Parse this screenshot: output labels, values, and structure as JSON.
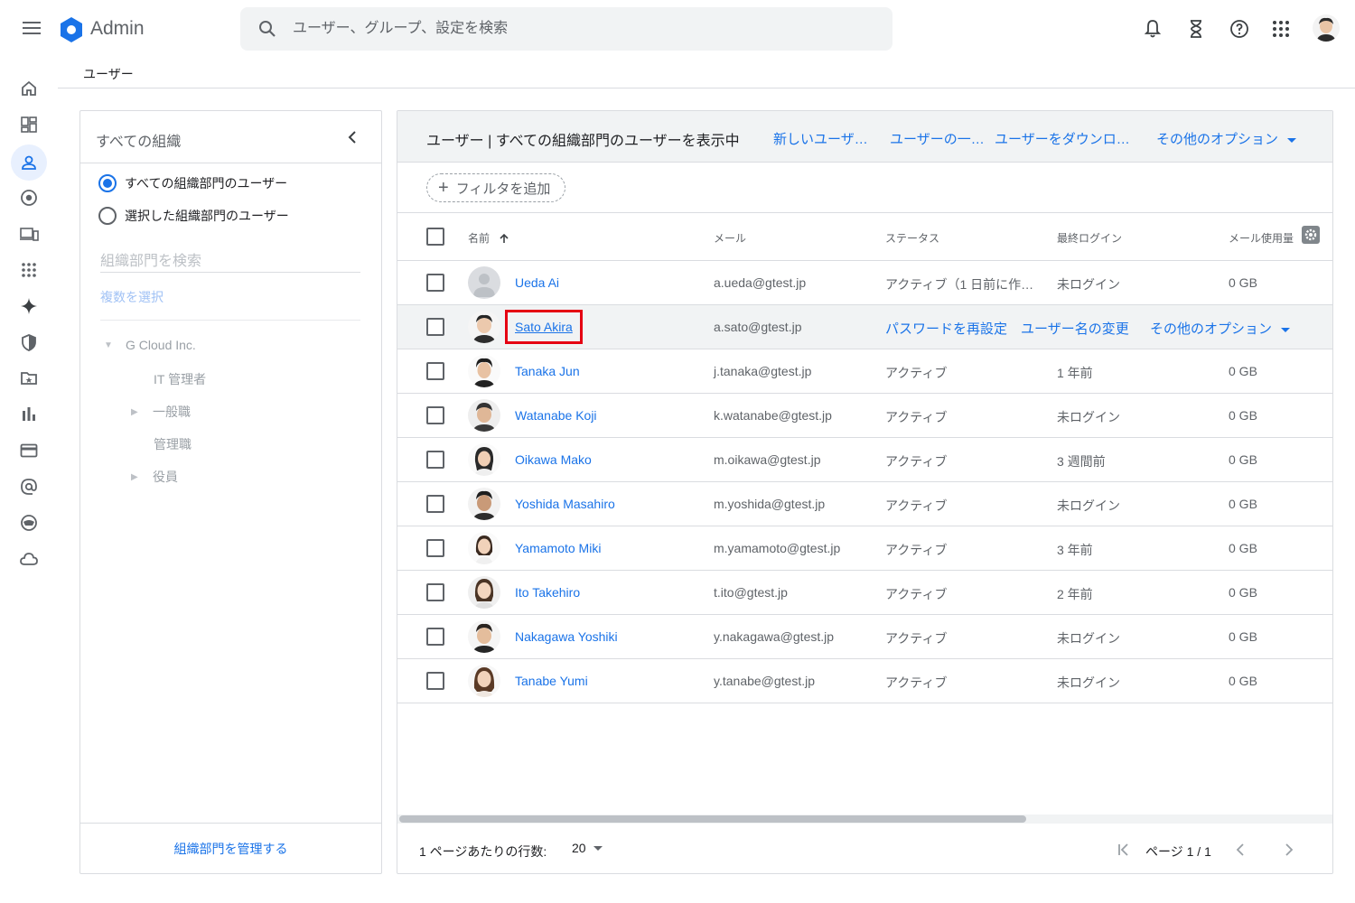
{
  "app": {
    "title": "Admin"
  },
  "search": {
    "placeholder": "ユーザー、グループ、設定を検索"
  },
  "breadcrumb": "ユーザー",
  "org_panel": {
    "title": "すべての組織",
    "radio_all": "すべての組織部門のユーザー",
    "radio_selected": "選択した組織部門のユーザー",
    "search_placeholder": "組織部門を検索",
    "multi_select": "複数を選択",
    "tree": [
      {
        "label": "G Cloud Inc."
      },
      {
        "label": "IT 管理者"
      },
      {
        "label": "一般職"
      },
      {
        "label": "管理職"
      },
      {
        "label": "役員"
      }
    ],
    "manage_link": "組織部門を管理する"
  },
  "users_panel": {
    "title": "ユーザー | すべての組織部門のユーザーを表示中",
    "links": {
      "new_user": "新しいユーザ…",
      "list": "ユーザーの一…",
      "download": "ユーザーをダウンロ…",
      "more": "その他のオプション"
    },
    "add_filter": "フィルタを追加",
    "columns": {
      "name": "名前",
      "email": "メール",
      "status": "ステータス",
      "last_login": "最終ログイン",
      "mail_usage": "メール使用量"
    },
    "rows": [
      {
        "name": "Ueda Ai",
        "email": "a.ueda@gtest.jp",
        "status": "アクティブ（1 日前に作…",
        "last_login": "未ログイン",
        "usage": "0 GB"
      },
      {
        "name": "Sato Akira",
        "email": "a.sato@gtest.jp",
        "status": "",
        "last_login": "",
        "usage": ""
      },
      {
        "name": "Tanaka Jun",
        "email": "j.tanaka@gtest.jp",
        "status": "アクティブ",
        "last_login": "1 年前",
        "usage": "0 GB"
      },
      {
        "name": "Watanabe Koji",
        "email": "k.watanabe@gtest.jp",
        "status": "アクティブ",
        "last_login": "未ログイン",
        "usage": "0 GB"
      },
      {
        "name": "Oikawa Mako",
        "email": "m.oikawa@gtest.jp",
        "status": "アクティブ",
        "last_login": "3 週間前",
        "usage": "0 GB"
      },
      {
        "name": "Yoshida Masahiro",
        "email": "m.yoshida@gtest.jp",
        "status": "アクティブ",
        "last_login": "未ログイン",
        "usage": "0 GB"
      },
      {
        "name": "Yamamoto Miki",
        "email": "m.yamamoto@gtest.jp",
        "status": "アクティブ",
        "last_login": "3 年前",
        "usage": "0 GB"
      },
      {
        "name": "Ito Takehiro",
        "email": "t.ito@gtest.jp",
        "status": "アクティブ",
        "last_login": "2 年前",
        "usage": "0 GB"
      },
      {
        "name": "Nakagawa Yoshiki",
        "email": "y.nakagawa@gtest.jp",
        "status": "アクティブ",
        "last_login": "未ログイン",
        "usage": "0 GB"
      },
      {
        "name": "Tanabe Yumi",
        "email": "y.tanabe@gtest.jp",
        "status": "アクティブ",
        "last_login": "未ログイン",
        "usage": "0 GB"
      }
    ],
    "hover_actions": {
      "reset_password": "パスワードを再設定",
      "rename": "ユーザー名の変更",
      "more": "その他のオプション"
    },
    "pager": {
      "rows_per_page_label": "1 ページあたりの行数:",
      "rows_per_page_value": "20",
      "page_label": "ページ 1 / 1"
    }
  },
  "colors": {
    "accent": "#1a73e8",
    "highlight_box": "#e50012"
  }
}
